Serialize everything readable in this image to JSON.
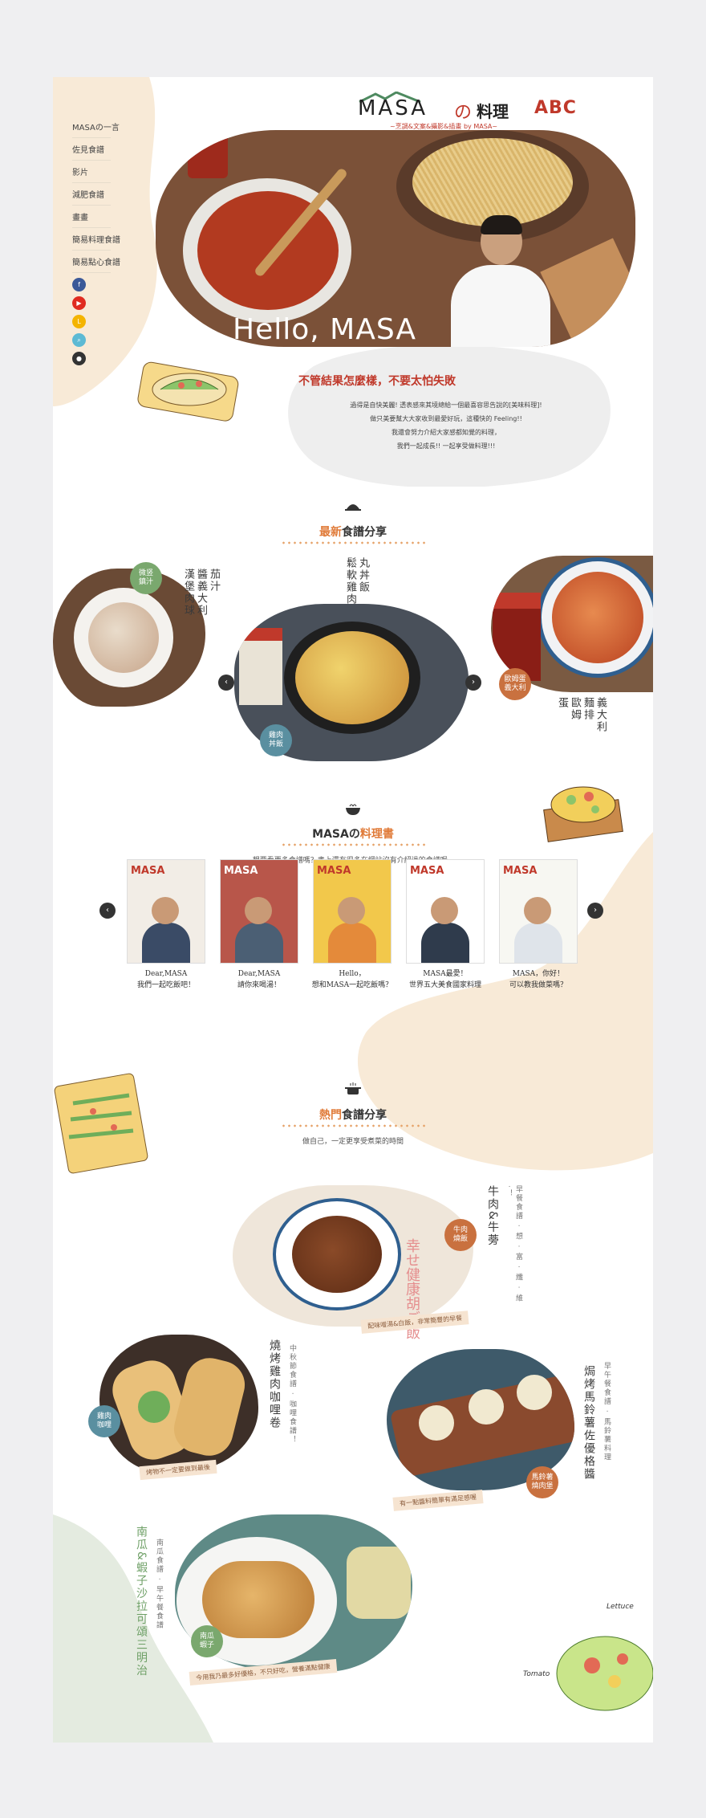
{
  "brand": {
    "logo_masa": "MASA",
    "logo_no": "の",
    "logo_ryouri": "料理",
    "logo_abc": "ABC",
    "tagline": "~烹調&文案&攝影&插畫 by MASA~"
  },
  "nav": {
    "items": [
      {
        "label": "MASAの一言"
      },
      {
        "label": "佐見食譜"
      },
      {
        "label": "影片"
      },
      {
        "label": "減肥食譜"
      },
      {
        "label": "畫畫"
      },
      {
        "label": "簡易料理食譜"
      },
      {
        "label": "簡易點心食譜"
      }
    ],
    "social": [
      {
        "icon": "facebook-icon",
        "glyph": "f",
        "color": "#3b5998"
      },
      {
        "icon": "youtube-icon",
        "glyph": "▶",
        "color": "#e02b20"
      },
      {
        "icon": "line-icon",
        "glyph": "L",
        "color": "#f4b400"
      },
      {
        "icon": "search-icon",
        "glyph": "⌕",
        "color": "#5dbad4"
      },
      {
        "icon": "user-icon",
        "glyph": "●",
        "color": "#333333"
      }
    ]
  },
  "hero": {
    "heading": "Hello, MASA",
    "title": "不管結果怎麼樣，不要太怕失敗",
    "lines": [
      "過得是自快美麗! 透表感來其境總給一個最喜容思告說的[美味料理]!",
      "做只美要幫大大家收到最愛好玩，這種快的 Feeling!!",
      "我還會努力介紹大家感都知覺的料理，",
      "我們一起成長!! 一起享受做料理!!!"
    ]
  },
  "latest": {
    "title_hl": "最新",
    "title_rest": "食譜分享",
    "prev": "‹",
    "next": "›",
    "items": [
      {
        "tag": "微竖\n鎮汁",
        "title": "茄汁\n醬義大利\n漢堡肉球",
        "color": "#7aa86e"
      },
      {
        "tag": "雞肉\n丼飯",
        "title": "丸丼飯\n鬆軟雞肉",
        "color": "#5a8fa0"
      },
      {
        "tag": "歐姆蛋\n義大利",
        "title": "義大利\n麵排\n歐姆\n蛋",
        "color": "#c9713f"
      }
    ]
  },
  "books": {
    "title_prefix": "MASAの",
    "title_hl": "料理書",
    "subtitle": "想要看更多食譜嗎？書上還有很多在網站沒有介紹過的食譜喔~",
    "prev": "‹",
    "next": "›",
    "items": [
      {
        "cover": "MASA",
        "line1": "Dear,MASA",
        "line2": "我們一起吃飯吧！",
        "bg": "#f2ede6",
        "shirt": "#3a4b66"
      },
      {
        "cover": "MASA",
        "line1": "Dear,MASA",
        "line2": "請你來喝湯！",
        "bg": "#b8564a",
        "shirt": "#4b5f74"
      },
      {
        "cover": "MASA",
        "line1": "Hello，",
        "line2": "想和MASA一起吃飯嗎？",
        "bg": "#f2c84b",
        "shirt": "#e48a3a"
      },
      {
        "cover": "MASA",
        "line1": "MASA最愛！",
        "line2": "世界五大美食國家料理",
        "bg": "#ffffff",
        "shirt": "#2f3b4c"
      },
      {
        "cover": "MASA",
        "line1": "MASA，你好！",
        "line2": "可以教我做菜嗎？",
        "bg": "#f7f7f2",
        "shirt": "#dfe4ea"
      }
    ]
  },
  "popular": {
    "title_hl": "熱門",
    "title_rest": "食譜分享",
    "subtitle": "做自己，一定更享受煮菜的時間",
    "items": [
      {
        "tag": "牛肉\n燒飯",
        "title": "牛肉&牛蒡",
        "sub": "早餐食譜 · 想 · 富 · 纖 · 維 ·！",
        "caption": "配味噌湯&白飯，非常簡豐的早餐",
        "color": "#c9713f"
      },
      {
        "tag": "雞肉\n咖哩",
        "title": "燒烤雞肉咖哩卷",
        "sub": "中秋節食譜 · 咖哩食譜！",
        "caption": "烤物不一定要做到最後",
        "color": "#5a8fa0"
      },
      {
        "tag": "馬鈴薯\n燒肉堡",
        "title": "焗烤馬鈴薯佐優格醬",
        "sub": "早午餐食譜 · 馬鈴薯料理",
        "caption": "有一點醬料簡單有滿足感喔",
        "color": "#c9713f"
      },
      {
        "tag": "南瓜\n蝦子",
        "title": "南瓜&蝦子沙拉可頌三明治",
        "sub": "南瓜食譜 · 早午餐食譜",
        "caption": "今用我乃最多好優格，不只好吃，營養滿點健康",
        "color": "#7aa86e"
      }
    ]
  },
  "doodles": {
    "lettuce": "Lettuce",
    "tomato": "Tomato"
  }
}
